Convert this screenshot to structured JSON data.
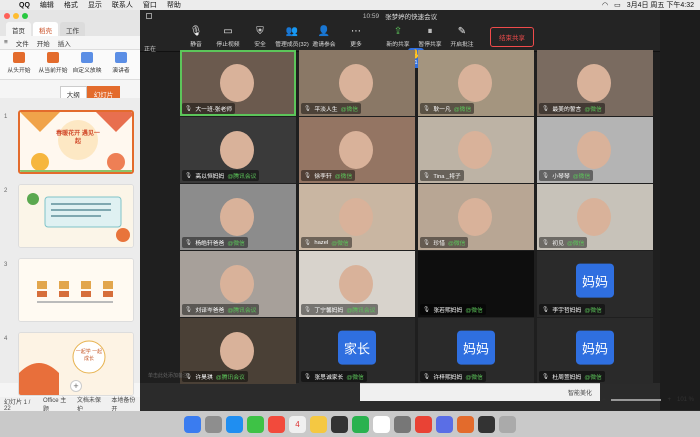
{
  "menubar": {
    "app": "QQ",
    "items": [
      "编辑",
      "格式",
      "显示",
      "联系人",
      "窗口",
      "帮助"
    ],
    "date": "3月4日 周五 下午4:32"
  },
  "wps": {
    "tabs": [
      "首页",
      "稻壳",
      "工作"
    ],
    "menu": [
      "文件",
      "开始",
      "插入"
    ],
    "ribbon": [
      "从头开始",
      "从当前开始",
      "自定义放映",
      "演讲者"
    ],
    "view_toggle": [
      "大纲",
      "幻灯片"
    ],
    "slide_numbers": [
      "1",
      "2",
      "3",
      "4"
    ],
    "slide1_title": "春暖花开 遇见一起",
    "slide4_text": "一起学 一起成长",
    "status": {
      "page": "幻灯片 1 / 22",
      "theme": "Office 主题",
      "protect": "文档未保护",
      "backup": "本地备份开"
    }
  },
  "zoom": {
    "time": "10:59",
    "title": "张梦婷的快速会议",
    "side_tab": "正在",
    "toolbar": [
      {
        "icon": "mic-icon",
        "glyph": "🎙",
        "label": "静音"
      },
      {
        "icon": "video-icon",
        "glyph": "▭",
        "label": "停止视频"
      },
      {
        "icon": "shield-icon",
        "glyph": "⛨",
        "label": "安全"
      },
      {
        "icon": "participants-icon",
        "glyph": "👥",
        "label": "管理成员(32)"
      },
      {
        "icon": "invite-icon",
        "glyph": "👤",
        "label": "邀请参会"
      },
      {
        "icon": "more-icon",
        "glyph": "⋯",
        "label": "更多"
      },
      {
        "icon": "share-icon",
        "glyph": "⇪",
        "label": "新的共享"
      },
      {
        "icon": "pause-icon",
        "glyph": "⏸",
        "label": "暂停共享"
      },
      {
        "icon": "annotate-icon",
        "glyph": "✎",
        "label": "开启批注"
      }
    ],
    "end_share": "结束共享",
    "hand_count": "1",
    "participants": [
      {
        "name": "大一班-张老师",
        "tag": "",
        "type": "video",
        "speaking": true
      },
      {
        "name": "平淡人生",
        "tag": "@微信",
        "type": "video"
      },
      {
        "name": "耿一凡",
        "tag": "@微信",
        "type": "video"
      },
      {
        "name": "最美的誓言",
        "tag": "@微信",
        "type": "video"
      },
      {
        "name": "高以恒妈妈",
        "tag": "@腾讯会议",
        "type": "video"
      },
      {
        "name": "徐李轩",
        "tag": "@微信",
        "type": "video"
      },
      {
        "name": "Tina _将子",
        "tag": "",
        "type": "video"
      },
      {
        "name": "小琴琴",
        "tag": "@微信",
        "type": "video"
      },
      {
        "name": "杨皓轩爸爸",
        "tag": "@微信",
        "type": "video"
      },
      {
        "name": "hazel",
        "tag": "@微信",
        "type": "video"
      },
      {
        "name": "珍惜",
        "tag": "@微信",
        "type": "video"
      },
      {
        "name": "初见",
        "tag": "@微信",
        "type": "video"
      },
      {
        "name": "刘译岑爸爸",
        "tag": "@腾讯会议",
        "type": "video"
      },
      {
        "name": "丁宁馨妈妈",
        "tag": "@腾讯会议",
        "type": "video"
      },
      {
        "name": "张若熙妈妈",
        "tag": "@微信",
        "type": "dark"
      },
      {
        "name": "李宇哲妈妈",
        "tag": "@微信",
        "type": "avatar",
        "avatar": "妈妈"
      },
      {
        "name": "许昊琪",
        "tag": "@腾讯会议",
        "type": "video"
      },
      {
        "name": "张思诚家长",
        "tag": "@微信",
        "type": "avatar",
        "avatar": "家长"
      },
      {
        "name": "许梓熙妈妈",
        "tag": "@微信",
        "type": "avatar",
        "avatar": "妈妈"
      },
      {
        "name": "杜周萱妈妈",
        "tag": "@微信",
        "type": "avatar",
        "avatar": "妈妈"
      }
    ]
  },
  "bottom": {
    "notice": "单击此处添加备注",
    "beautify": "智能美化",
    "zoom_level": "101 %"
  },
  "colors": {
    "accent_orange": "#e36b2c",
    "zoom_blue": "#2f6fe0",
    "wechat_green": "#5cc55a",
    "end_red": "#f04b4b"
  }
}
